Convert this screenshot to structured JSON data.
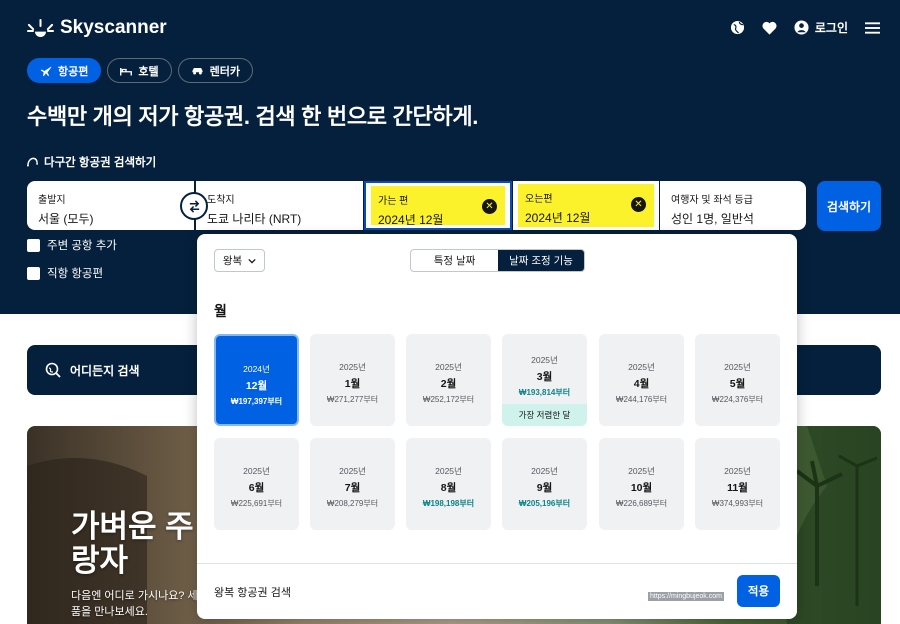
{
  "brand": {
    "name": "Skyscanner"
  },
  "header": {
    "login": "로그인",
    "icons": [
      "globe-icon",
      "heart-icon",
      "user-icon",
      "menu-icon"
    ]
  },
  "tabs": [
    {
      "label": "항공편",
      "icon": "plane-icon",
      "active": true
    },
    {
      "label": "호텔",
      "icon": "bed-icon"
    },
    {
      "label": "렌터카",
      "icon": "car-icon"
    }
  ],
  "headline": "수백만 개의 저가 항공권. 검색 한 번으로 간단하게.",
  "multicity": "다구간 항공권 검색하기",
  "search": {
    "from": {
      "label": "출발지",
      "value": "서울 (모두)"
    },
    "to": {
      "label": "도착지",
      "value": "도쿄 나리타 (NRT)"
    },
    "depart": {
      "label": "가는 편",
      "value": "2024년 12월"
    },
    "return": {
      "label": "오는편",
      "value": "2024년 12월"
    },
    "pax": {
      "label": "여행자 및 좌석 등급",
      "value": "성인 1명, 일반석"
    },
    "button": "검색하기"
  },
  "checkboxes": {
    "nearby": "주변 공항 추가",
    "direct": "직항 항공편"
  },
  "anywhere": "어디든지 검색",
  "promo": {
    "title1": "가벼운 주",
    "title2": "랑자",
    "sub1": "다음엔 어디로 가시나요? 세",
    "sub2": "품을 만나보세요."
  },
  "popup": {
    "trip_type": "왕복",
    "seg_specific": "특정 날짜",
    "seg_flex": "날짜 조정 기능",
    "month_heading": "월",
    "months": [
      {
        "year": "2024년",
        "month": "12월",
        "price": "₩197,397부터",
        "selected": true
      },
      {
        "year": "2025년",
        "month": "1월",
        "price": "₩271,277부터"
      },
      {
        "year": "2025년",
        "month": "2월",
        "price": "₩252,172부터"
      },
      {
        "year": "2025년",
        "month": "3월",
        "price": "₩193,814부터",
        "cheap": "가장 저렴한 달",
        "green": true
      },
      {
        "year": "2025년",
        "month": "4월",
        "price": "₩244,176부터"
      },
      {
        "year": "2025년",
        "month": "5월",
        "price": "₩224,376부터"
      },
      {
        "year": "2025년",
        "month": "6월",
        "price": "₩225,691부터"
      },
      {
        "year": "2025년",
        "month": "7월",
        "price": "₩208,279부터"
      },
      {
        "year": "2025년",
        "month": "8월",
        "price": "₩198,198부터",
        "green": true
      },
      {
        "year": "2025년",
        "month": "9월",
        "price": "₩205,196부터",
        "green": true
      },
      {
        "year": "2025년",
        "month": "10월",
        "price": "₩226,689부터"
      },
      {
        "year": "2025년",
        "month": "11월",
        "price": "₩374,993부터"
      }
    ],
    "footer_text": "왕복 항공권 검색",
    "watermark": "https://mingbujeok.com",
    "apply": "적용"
  }
}
